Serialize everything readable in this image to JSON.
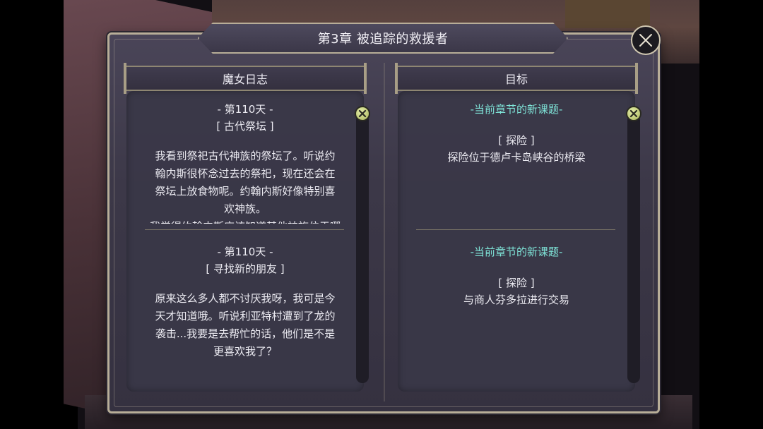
{
  "header": {
    "title": "第3章  被追踪的救援者"
  },
  "close_button": {
    "icon": "close-icon"
  },
  "journal": {
    "title": "魔女日志",
    "entries": [
      {
        "day": "- 第110天 -",
        "tag": "[ 古代祭坛 ]",
        "lines": [
          "我看到祭祀古代神族的祭坛了。听说约",
          "翰内斯很怀念过去的祭祀，现在还会在",
          "祭坛上放食物呢。约翰内斯好像特别喜",
          "欢神族。"
        ],
        "cut_line": "我觉得约翰内斯应该知道其他神族位于哪"
      },
      {
        "day": "- 第110天 -",
        "tag": "[ 寻找新的朋友 ]",
        "lines": [
          "原来这么多人都不讨厌我呀，我可是今",
          "天才知道哦。听说利亚特村遭到了龙的",
          "袭击...我要是去帮忙的话，他们是不是",
          "更喜欢我了？"
        ]
      }
    ]
  },
  "goals": {
    "title": "目标",
    "entries": [
      {
        "heading": "-当前章节的新课题-",
        "tag": "[ 探险 ]",
        "desc": "探险位于德卢卡岛峡谷的桥梁"
      },
      {
        "heading": "-当前章节的新课题-",
        "tag": "[ 探险  ]",
        "desc": "与商人芬多拉进行交易"
      }
    ]
  },
  "colors": {
    "accent": "#7fe4d8",
    "frame": "#b8ae98",
    "panel": "#3c3848"
  }
}
